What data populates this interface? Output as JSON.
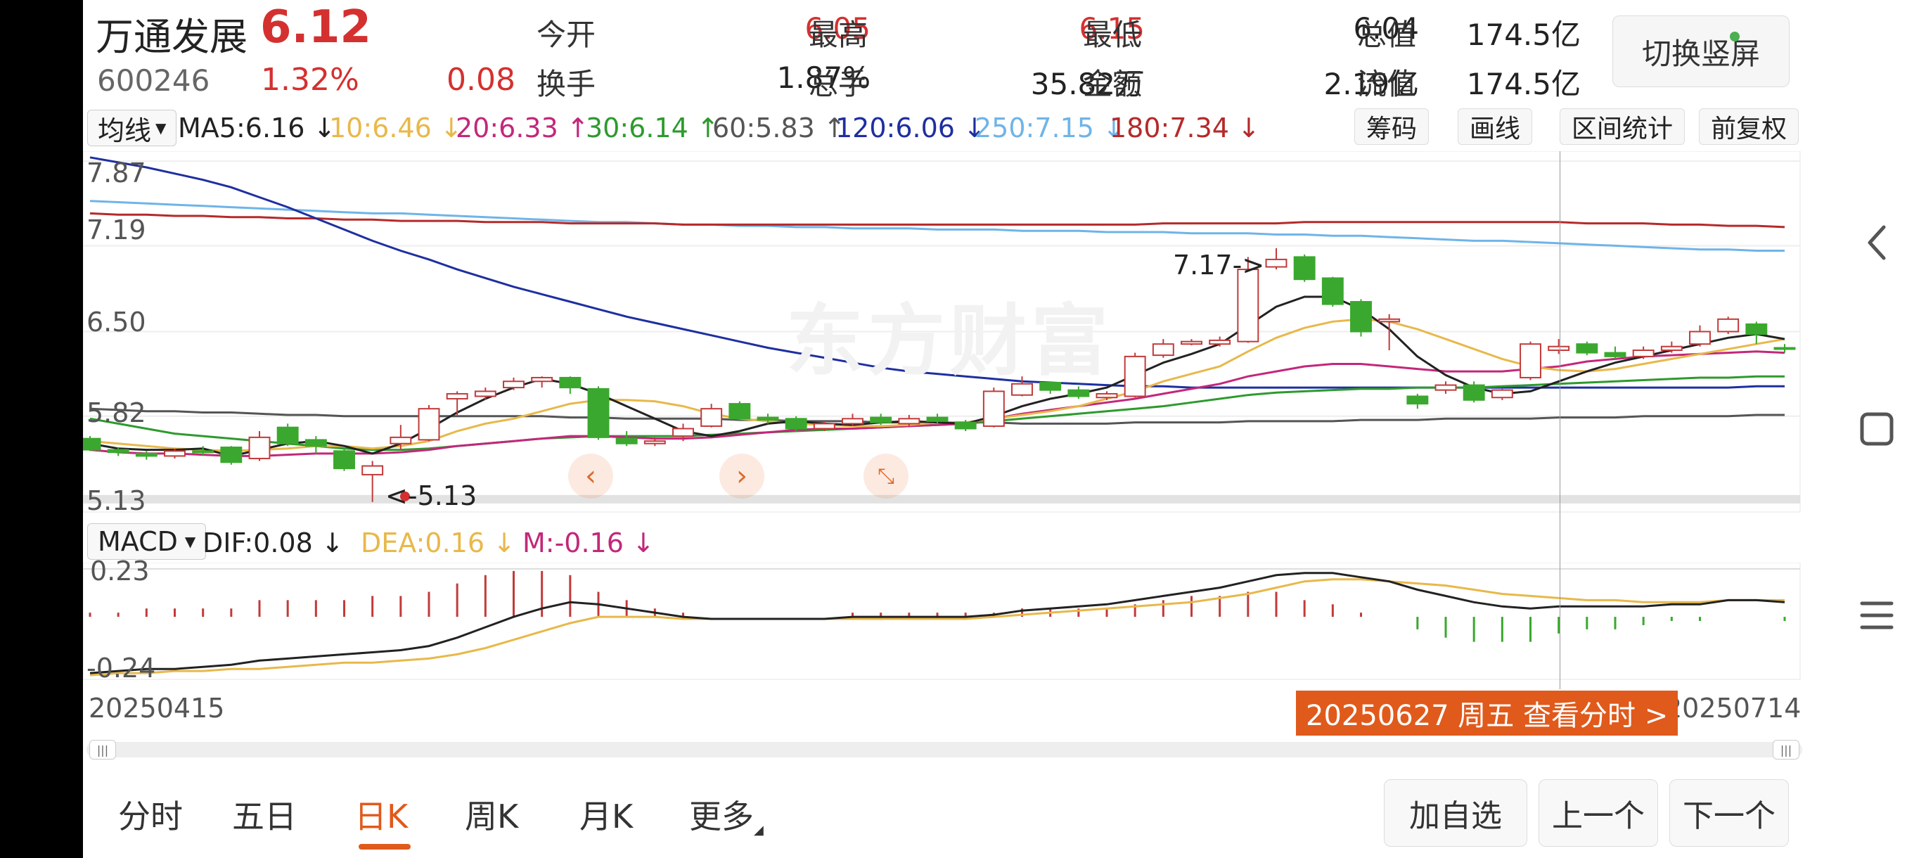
{
  "stock": {
    "name": "万通发展",
    "price": "6.12",
    "code": "600246",
    "change_pct": "1.32%",
    "change": "0.08"
  },
  "quote": {
    "open_label": "今开",
    "open": "6.05",
    "high_label": "最高",
    "high": "6.15",
    "low_label": "最低",
    "low": "6.04",
    "total_cap_label": "总值",
    "total_cap": "174.5亿",
    "turnover_label": "换手",
    "turnover": "1.87%",
    "volume_label": "总手",
    "volume": "35.82万",
    "amount_label": "金额",
    "amount": "2.19亿",
    "float_cap_label": "流值",
    "float_cap": "174.5亿"
  },
  "switch_button": "切换竖屏",
  "ma_bar": {
    "selector": "均线",
    "items": [
      {
        "text": "MA5:6.16 ↓",
        "color": "#222222"
      },
      {
        "text": "10:6.46 ↓",
        "color": "#e8b84a"
      },
      {
        "text": "20:6.33 ↑",
        "color": "#c2287a"
      },
      {
        "text": "30:6.14 ↑",
        "color": "#2e9a2e"
      },
      {
        "text": "60:5.83 ↑",
        "color": "#555555"
      },
      {
        "text": "120:6.06 ↓",
        "color": "#1e2fa0"
      },
      {
        "text": "250:7.15 ↓",
        "color": "#6fb4e8"
      },
      {
        "text": "180:7.34 ↓",
        "color": "#b52a2a"
      }
    ],
    "buttons": [
      "筹码",
      "画线",
      "区间统计",
      "前复权"
    ]
  },
  "price_axis": [
    "7.87",
    "7.19",
    "6.50",
    "5.82",
    "5.13"
  ],
  "annotations": {
    "high_mark": "7.17->",
    "low_mark": "<-5.13"
  },
  "watermark": "东方财富",
  "macd_bar": {
    "selector": "MACD",
    "items": [
      {
        "text": "DIF:0.08 ↓",
        "color": "#222222"
      },
      {
        "text": "DEA:0.16 ↓",
        "color": "#e8b84a"
      },
      {
        "text": "M:-0.16 ↓",
        "color": "#c2287a"
      }
    ],
    "axis_top": "0.23",
    "axis_bottom": "-0.24"
  },
  "dates": {
    "start": "20250415",
    "end": "20250714"
  },
  "tooltip": "20250627 周五  查看分时 >",
  "tabs": [
    "分时",
    "五日",
    "日K",
    "周K",
    "月K",
    "更多"
  ],
  "active_tab": "日K",
  "bottom_buttons": [
    "加自选",
    "上一个",
    "下一个"
  ],
  "chart_data": {
    "type": "candlestick",
    "candles": [
      [
        5.64,
        5.55,
        5.66,
        5.54
      ],
      [
        5.55,
        5.53,
        5.57,
        5.5
      ],
      [
        5.52,
        5.5,
        5.54,
        5.47
      ],
      [
        5.5,
        5.54,
        5.56,
        5.48
      ],
      [
        5.54,
        5.53,
        5.58,
        5.5
      ],
      [
        5.57,
        5.45,
        5.58,
        5.43
      ],
      [
        5.48,
        5.65,
        5.7,
        5.46
      ],
      [
        5.73,
        5.6,
        5.76,
        5.58
      ],
      [
        5.63,
        5.58,
        5.66,
        5.52
      ],
      [
        5.54,
        5.4,
        5.56,
        5.38
      ],
      [
        5.35,
        5.42,
        5.46,
        5.13
      ],
      [
        5.6,
        5.65,
        5.75,
        5.55
      ],
      [
        5.63,
        5.88,
        5.91,
        5.62
      ],
      [
        5.96,
        6.0,
        6.02,
        5.83
      ],
      [
        5.98,
        6.02,
        6.05,
        5.95
      ],
      [
        6.05,
        6.1,
        6.13,
        6.03
      ],
      [
        6.1,
        6.13,
        6.14,
        6.05
      ],
      [
        6.13,
        6.05,
        6.14,
        6.0
      ],
      [
        6.04,
        5.65,
        6.06,
        5.63
      ],
      [
        5.64,
        5.6,
        5.7,
        5.58
      ],
      [
        5.6,
        5.62,
        5.65,
        5.58
      ],
      [
        5.66,
        5.72,
        5.76,
        5.62
      ],
      [
        5.74,
        5.88,
        5.92,
        5.73
      ],
      [
        5.92,
        5.8,
        5.94,
        5.78
      ],
      [
        5.81,
        5.79,
        5.84,
        5.76
      ],
      [
        5.8,
        5.72,
        5.82,
        5.7
      ],
      [
        5.72,
        5.76,
        5.78,
        5.7
      ],
      [
        5.76,
        5.8,
        5.84,
        5.74
      ],
      [
        5.81,
        5.77,
        5.84,
        5.75
      ],
      [
        5.76,
        5.8,
        5.83,
        5.74
      ],
      [
        5.81,
        5.78,
        5.84,
        5.75
      ],
      [
        5.77,
        5.72,
        5.79,
        5.7
      ],
      [
        5.74,
        6.02,
        6.05,
        5.73
      ],
      [
        5.99,
        6.08,
        6.14,
        5.98
      ],
      [
        6.09,
        6.03,
        6.1,
        6.0
      ],
      [
        6.03,
        5.98,
        6.06,
        5.96
      ],
      [
        5.97,
        6.0,
        6.02,
        5.95
      ],
      [
        5.98,
        6.3,
        6.33,
        5.97
      ],
      [
        6.31,
        6.4,
        6.44,
        6.29
      ],
      [
        6.4,
        6.42,
        6.44,
        6.39
      ],
      [
        6.4,
        6.43,
        6.46,
        6.38
      ],
      [
        6.42,
        7.0,
        7.1,
        6.41
      ],
      [
        7.02,
        7.08,
        7.17,
        7.0
      ],
      [
        7.1,
        6.92,
        7.12,
        6.9
      ],
      [
        6.93,
        6.72,
        6.94,
        6.7
      ],
      [
        6.74,
        6.5,
        6.76,
        6.46
      ],
      [
        6.58,
        6.6,
        6.64,
        6.35
      ],
      [
        5.98,
        5.92,
        6.0,
        5.88
      ],
      [
        6.03,
        6.07,
        6.1,
        6.0
      ],
      [
        6.07,
        5.95,
        6.1,
        5.93
      ],
      [
        5.97,
        6.03,
        6.04,
        5.95
      ],
      [
        6.13,
        6.4,
        6.42,
        6.11
      ],
      [
        6.35,
        6.38,
        6.44,
        6.32
      ],
      [
        6.4,
        6.33,
        6.42,
        6.31
      ],
      [
        6.33,
        6.3,
        6.38,
        6.28
      ],
      [
        6.3,
        6.35,
        6.38,
        6.28
      ],
      [
        6.35,
        6.38,
        6.42,
        6.33
      ],
      [
        6.4,
        6.5,
        6.55,
        6.38
      ],
      [
        6.5,
        6.6,
        6.62,
        6.48
      ],
      [
        6.56,
        6.48,
        6.58,
        6.4
      ],
      [
        6.37,
        6.36,
        6.4,
        6.33
      ]
    ],
    "ma": {
      "MA5": [
        5.6,
        5.56,
        5.55,
        5.55,
        5.56,
        5.5,
        5.55,
        5.6,
        5.62,
        5.58,
        5.52,
        5.6,
        5.72,
        5.85,
        5.96,
        6.05,
        6.12,
        6.08,
        6.0,
        5.9,
        5.8,
        5.7,
        5.66,
        5.7,
        5.76,
        5.78,
        5.76,
        5.75,
        5.77,
        5.78,
        5.77,
        5.76,
        5.82,
        5.9,
        5.96,
        6.0,
        6.05,
        6.15,
        6.25,
        6.32,
        6.4,
        6.55,
        6.7,
        6.78,
        6.78,
        6.68,
        6.52,
        6.3,
        6.15,
        6.05,
        6.0,
        6.02,
        6.1,
        6.18,
        6.25,
        6.3,
        6.35,
        6.4,
        6.45,
        6.48,
        6.44
      ],
      "MA10": [
        5.62,
        5.6,
        5.58,
        5.56,
        5.55,
        5.54,
        5.55,
        5.56,
        5.58,
        5.58,
        5.56,
        5.58,
        5.62,
        5.7,
        5.76,
        5.8,
        5.86,
        5.92,
        5.95,
        5.95,
        5.94,
        5.9,
        5.84,
        5.8,
        5.78,
        5.76,
        5.75,
        5.74,
        5.74,
        5.75,
        5.77,
        5.77,
        5.8,
        5.83,
        5.86,
        5.9,
        5.96,
        6.02,
        6.1,
        6.16,
        6.22,
        6.34,
        6.45,
        6.53,
        6.58,
        6.6,
        6.58,
        6.52,
        6.44,
        6.36,
        6.28,
        6.22,
        6.19,
        6.18,
        6.2,
        6.24,
        6.28,
        6.32,
        6.36,
        6.4,
        6.44
      ],
      "MA20": [
        5.55,
        5.53,
        5.52,
        5.52,
        5.51,
        5.5,
        5.5,
        5.51,
        5.52,
        5.52,
        5.52,
        5.53,
        5.55,
        5.58,
        5.6,
        5.62,
        5.64,
        5.66,
        5.66,
        5.65,
        5.64,
        5.64,
        5.65,
        5.67,
        5.69,
        5.71,
        5.72,
        5.72,
        5.73,
        5.74,
        5.75,
        5.76,
        5.8,
        5.84,
        5.87,
        5.9,
        5.93,
        5.96,
        6.0,
        6.04,
        6.08,
        6.14,
        6.18,
        6.22,
        6.24,
        6.24,
        6.22,
        6.2,
        6.18,
        6.18,
        6.18,
        6.2,
        6.22,
        6.26,
        6.28,
        6.3,
        6.31,
        6.32,
        6.33,
        6.34,
        6.33
      ],
      "MA30": [
        5.8,
        5.76,
        5.72,
        5.68,
        5.66,
        5.64,
        5.62,
        5.6,
        5.58,
        5.56,
        5.55,
        5.55,
        5.56,
        5.58,
        5.6,
        5.62,
        5.64,
        5.65,
        5.66,
        5.66,
        5.66,
        5.66,
        5.67,
        5.68,
        5.69,
        5.7,
        5.71,
        5.72,
        5.73,
        5.74,
        5.75,
        5.76,
        5.78,
        5.8,
        5.82,
        5.84,
        5.86,
        5.88,
        5.9,
        5.93,
        5.96,
        5.99,
        6.01,
        6.02,
        6.03,
        6.04,
        6.04,
        6.05,
        6.05,
        6.05,
        6.06,
        6.07,
        6.08,
        6.09,
        6.1,
        6.11,
        6.12,
        6.13,
        6.13,
        6.14,
        6.14
      ],
      "MA60": [
        5.88,
        5.87,
        5.86,
        5.86,
        5.85,
        5.85,
        5.84,
        5.83,
        5.83,
        5.82,
        5.82,
        5.82,
        5.82,
        5.82,
        5.82,
        5.82,
        5.82,
        5.81,
        5.81,
        5.8,
        5.8,
        5.8,
        5.8,
        5.79,
        5.79,
        5.78,
        5.78,
        5.78,
        5.77,
        5.77,
        5.77,
        5.77,
        5.77,
        5.76,
        5.76,
        5.76,
        5.76,
        5.77,
        5.77,
        5.77,
        5.77,
        5.78,
        5.78,
        5.78,
        5.78,
        5.79,
        5.79,
        5.79,
        5.8,
        5.8,
        5.8,
        5.8,
        5.81,
        5.81,
        5.81,
        5.82,
        5.82,
        5.82,
        5.82,
        5.83,
        5.83
      ],
      "MA120": [
        7.9,
        7.86,
        7.82,
        7.77,
        7.72,
        7.66,
        7.58,
        7.5,
        7.41,
        7.32,
        7.23,
        7.15,
        7.08,
        7.0,
        6.93,
        6.86,
        6.8,
        6.74,
        6.68,
        6.62,
        6.57,
        6.52,
        6.47,
        6.42,
        6.37,
        6.33,
        6.29,
        6.25,
        6.21,
        6.18,
        6.16,
        6.14,
        6.12,
        6.1,
        6.09,
        6.08,
        6.07,
        6.06,
        6.06,
        6.05,
        6.05,
        6.05,
        6.05,
        6.05,
        6.05,
        6.05,
        6.05,
        6.05,
        6.05,
        6.05,
        6.05,
        6.05,
        6.05,
        6.05,
        6.05,
        6.05,
        6.05,
        6.05,
        6.05,
        6.06,
        6.06
      ],
      "MA250": [
        7.55,
        7.54,
        7.53,
        7.52,
        7.51,
        7.5,
        7.49,
        7.48,
        7.47,
        7.46,
        7.45,
        7.45,
        7.44,
        7.43,
        7.42,
        7.41,
        7.4,
        7.39,
        7.38,
        7.38,
        7.37,
        7.36,
        7.36,
        7.35,
        7.35,
        7.34,
        7.34,
        7.33,
        7.33,
        7.33,
        7.32,
        7.32,
        7.32,
        7.31,
        7.31,
        7.31,
        7.3,
        7.3,
        7.3,
        7.29,
        7.29,
        7.29,
        7.28,
        7.28,
        7.27,
        7.27,
        7.26,
        7.25,
        7.24,
        7.23,
        7.23,
        7.22,
        7.21,
        7.2,
        7.19,
        7.18,
        7.17,
        7.16,
        7.16,
        7.15,
        7.15
      ],
      "MA180": [
        7.45,
        7.44,
        7.44,
        7.43,
        7.43,
        7.42,
        7.42,
        7.41,
        7.41,
        7.4,
        7.4,
        7.39,
        7.39,
        7.39,
        7.38,
        7.38,
        7.38,
        7.37,
        7.37,
        7.37,
        7.37,
        7.36,
        7.36,
        7.36,
        7.36,
        7.36,
        7.36,
        7.36,
        7.36,
        7.36,
        7.36,
        7.36,
        7.36,
        7.36,
        7.36,
        7.36,
        7.36,
        7.36,
        7.37,
        7.37,
        7.37,
        7.37,
        7.37,
        7.38,
        7.38,
        7.38,
        7.38,
        7.38,
        7.38,
        7.38,
        7.38,
        7.38,
        7.38,
        7.37,
        7.37,
        7.37,
        7.36,
        7.36,
        7.35,
        7.35,
        7.34
      ]
    },
    "macd": {
      "dif": [
        -0.27,
        -0.26,
        -0.25,
        -0.25,
        -0.24,
        -0.23,
        -0.21,
        -0.2,
        -0.19,
        -0.18,
        -0.17,
        -0.16,
        -0.14,
        -0.1,
        -0.05,
        0.0,
        0.04,
        0.07,
        0.06,
        0.04,
        0.02,
        0.0,
        -0.01,
        -0.01,
        -0.01,
        -0.01,
        -0.01,
        0.0,
        0.0,
        0.0,
        0.0,
        0.0,
        0.01,
        0.03,
        0.04,
        0.05,
        0.06,
        0.08,
        0.1,
        0.12,
        0.14,
        0.17,
        0.2,
        0.21,
        0.21,
        0.19,
        0.17,
        0.13,
        0.1,
        0.07,
        0.05,
        0.04,
        0.05,
        0.05,
        0.05,
        0.05,
        0.06,
        0.06,
        0.08,
        0.08,
        0.07
      ],
      "dea": [
        -0.28,
        -0.27,
        -0.27,
        -0.26,
        -0.26,
        -0.25,
        -0.25,
        -0.24,
        -0.23,
        -0.22,
        -0.22,
        -0.21,
        -0.2,
        -0.18,
        -0.15,
        -0.11,
        -0.07,
        -0.03,
        0.0,
        0.0,
        0.0,
        -0.01,
        -0.01,
        -0.01,
        -0.01,
        -0.01,
        -0.01,
        -0.01,
        -0.01,
        -0.01,
        -0.01,
        -0.01,
        0.0,
        0.01,
        0.02,
        0.03,
        0.04,
        0.05,
        0.06,
        0.07,
        0.09,
        0.11,
        0.14,
        0.17,
        0.18,
        0.18,
        0.17,
        0.16,
        0.15,
        0.13,
        0.11,
        0.1,
        0.09,
        0.08,
        0.08,
        0.07,
        0.07,
        0.07,
        0.08,
        0.08,
        0.08
      ],
      "m": [
        0.02,
        0.02,
        0.04,
        0.04,
        0.04,
        0.04,
        0.08,
        0.08,
        0.08,
        0.08,
        0.1,
        0.1,
        0.12,
        0.16,
        0.2,
        0.22,
        0.22,
        0.2,
        0.12,
        0.08,
        0.04,
        0.02,
        0.0,
        0.0,
        0.0,
        0.0,
        0.0,
        0.02,
        0.02,
        0.02,
        0.02,
        0.02,
        0.02,
        0.04,
        0.04,
        0.04,
        0.04,
        0.06,
        0.08,
        0.1,
        0.1,
        0.12,
        0.12,
        0.08,
        0.06,
        0.02,
        0.0,
        -0.06,
        -0.1,
        -0.12,
        -0.12,
        -0.12,
        -0.08,
        -0.06,
        -0.06,
        -0.04,
        -0.02,
        -0.02,
        0.0,
        0.0,
        -0.02
      ]
    }
  }
}
